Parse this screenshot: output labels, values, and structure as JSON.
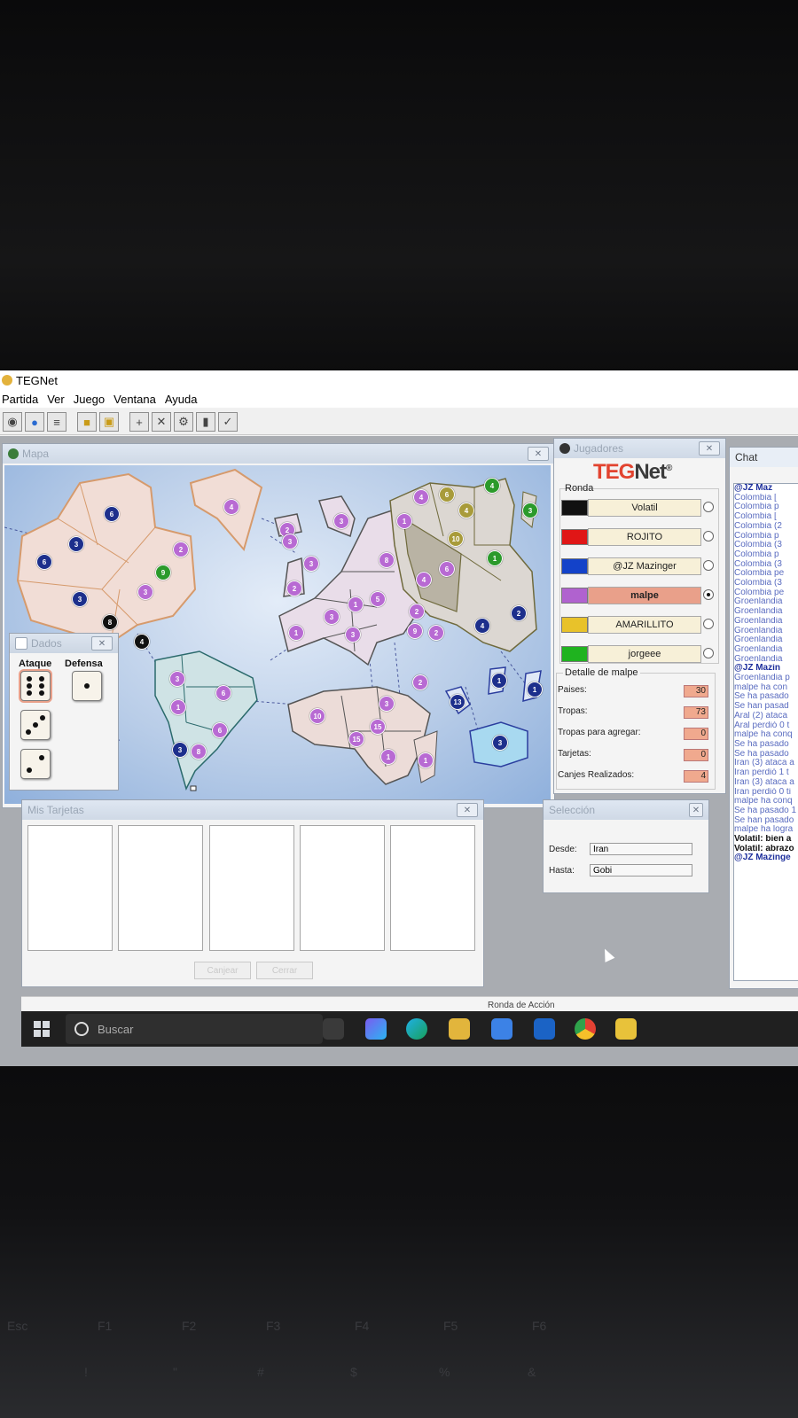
{
  "window": {
    "title": "TEGNet"
  },
  "menu": [
    "Partida",
    "Ver",
    "Juego",
    "Ventana",
    "Ayuda"
  ],
  "toolbar": {
    "icons": [
      "connect-icon",
      "globe-icon",
      "list-icon",
      "folder-icon",
      "card-icon",
      "add-icon",
      "cancel-icon",
      "settings-icon",
      "cards-icon",
      "check-icon"
    ]
  },
  "map": {
    "title": "Mapa",
    "armies": [
      "6",
      "3",
      "6",
      "3",
      "2",
      "9",
      "3",
      "4",
      "8",
      "2",
      "4",
      "3",
      "2",
      "1",
      "8",
      "3",
      "1",
      "5",
      "2",
      "3",
      "9",
      "2",
      "4",
      "1",
      "6",
      "4",
      "4",
      "10",
      "3",
      "6",
      "4",
      "1",
      "2",
      "4",
      "1",
      "13",
      "1",
      "3",
      "3",
      "6",
      "1",
      "6",
      "8",
      "3",
      "10",
      "3",
      "15",
      "15",
      "1",
      "1",
      "3",
      "3",
      "2"
    ]
  },
  "dados": {
    "title": "Dados",
    "ataque": "Ataque",
    "defensa": "Defensa",
    "attack_dice": [
      6,
      3,
      2
    ],
    "defense_dice": [
      1
    ]
  },
  "jugadores": {
    "title": "Jugadores",
    "logo_teg": "TEG",
    "logo_net": "Net",
    "logo_reg": "®",
    "ronda_label": "Ronda",
    "players": [
      {
        "name": "Volatil",
        "color": "#111111",
        "active": false
      },
      {
        "name": "ROJITO",
        "color": "#e01616",
        "active": false
      },
      {
        "name": "@JZ Mazinger",
        "color": "#1342c9",
        "active": false
      },
      {
        "name": "malpe",
        "color": "#b062cf",
        "active": true
      },
      {
        "name": "AMARILLITO",
        "color": "#e8c22a",
        "active": false
      },
      {
        "name": "jorgeee",
        "color": "#1fb31f",
        "active": false
      }
    ],
    "detalle_label": "Detalle de malpe",
    "detalle": [
      {
        "label": "Paises:",
        "value": "30"
      },
      {
        "label": "Tropas:",
        "value": "73"
      },
      {
        "label": "Tropas para agregar:",
        "value": "0"
      },
      {
        "label": "Tarjetas:",
        "value": "0"
      },
      {
        "label": "Canjes Realizados:",
        "value": "4"
      }
    ]
  },
  "chat": {
    "title": "Chat",
    "lines": [
      {
        "t": "@JZ Maz",
        "s": "b"
      },
      {
        "t": "Colombia ["
      },
      {
        "t": "Colombia p"
      },
      {
        "t": "Colombia ["
      },
      {
        "t": "Colombia (2"
      },
      {
        "t": "Colombia p"
      },
      {
        "t": "Colombia (3"
      },
      {
        "t": "Colombia p"
      },
      {
        "t": "Colombia (3"
      },
      {
        "t": "Colombia pe"
      },
      {
        "t": "Colombia (3"
      },
      {
        "t": "Colombia pe"
      },
      {
        "t": "Groenlandia"
      },
      {
        "t": "Groenlandia"
      },
      {
        "t": "Groenlandia"
      },
      {
        "t": "Groenlandia"
      },
      {
        "t": "Groenlandia"
      },
      {
        "t": "Groenlandia"
      },
      {
        "t": "Groenlandia"
      },
      {
        "t": "@JZ Mazin",
        "s": "b"
      },
      {
        "t": "Groenlandia p"
      },
      {
        "t": "malpe ha con"
      },
      {
        "t": "Se ha pasado"
      },
      {
        "t": "Se han pasad"
      },
      {
        "t": "Aral (2) ataca"
      },
      {
        "t": "Aral perdió 0 t"
      },
      {
        "t": "malpe ha conq"
      },
      {
        "t": "Se ha pasado"
      },
      {
        "t": "Se ha pasado"
      },
      {
        "t": "Iran (3) ataca a"
      },
      {
        "t": "Iran perdió 1 t"
      },
      {
        "t": "Iran (3) ataca a"
      },
      {
        "t": "Iran perdió 0 ti"
      },
      {
        "t": "malpe ha conq"
      },
      {
        "t": "Se ha pasado 1"
      },
      {
        "t": "Se han pasado"
      },
      {
        "t": "malpe ha logra"
      },
      {
        "t": "Volatil: bien a",
        "s": "k"
      },
      {
        "t": "Volatil: abrazo",
        "s": "k"
      },
      {
        "t": "@JZ Mazinge",
        "s": "b"
      }
    ]
  },
  "seleccion": {
    "title": "Selección",
    "desde_label": "Desde:",
    "desde": "Iran",
    "hasta_label": "Hasta:",
    "hasta": "Gobi"
  },
  "tarjetas": {
    "title": "Mis Tarjetas",
    "btn1": "Canjear",
    "btn2": "Cerrar"
  },
  "status": {
    "text": "Ronda de Acción"
  },
  "taskbar": {
    "search": "Buscar"
  },
  "keyboard": [
    "Esc",
    "F1",
    "F2",
    "F3",
    "F4",
    "F5",
    "F6",
    "!",
    "\"",
    "#",
    "$",
    "%",
    "&"
  ]
}
